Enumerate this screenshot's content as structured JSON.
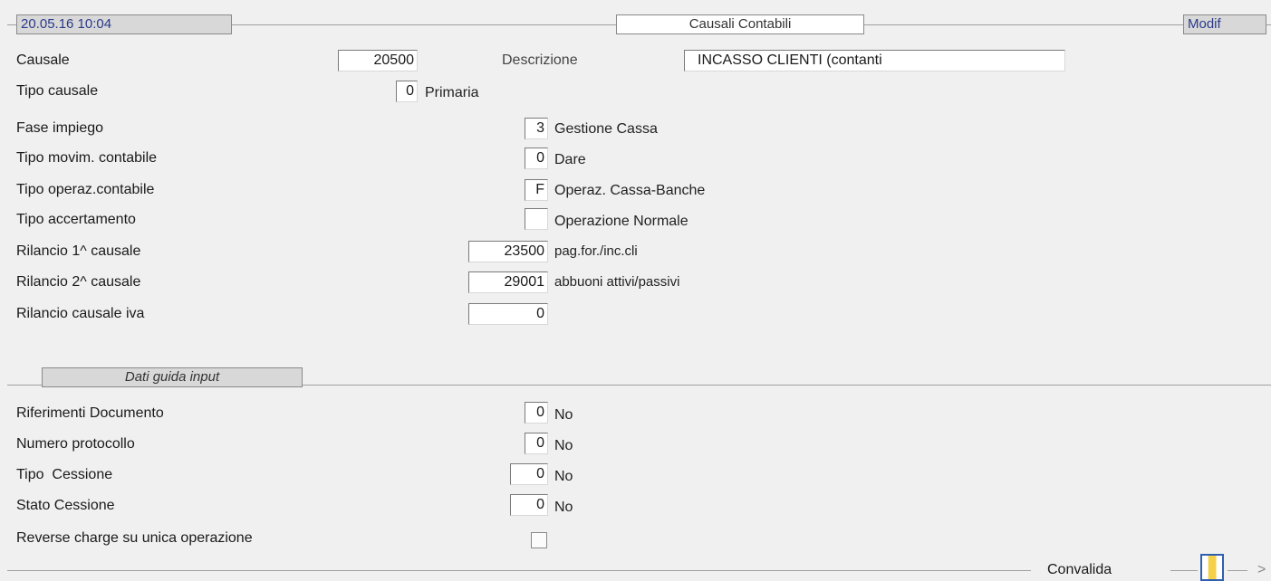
{
  "header": {
    "datetime": "20.05.16 10:04",
    "title": "Causali Contabili",
    "mode": "Modif"
  },
  "form": {
    "causale": {
      "label": "Causale",
      "value": "20500"
    },
    "descrizione": {
      "label": "Descrizione",
      "value": "INCASSO CLIENTI (contanti"
    },
    "tipo_causale": {
      "label": "Tipo causale",
      "value": "0",
      "desc": "Primaria"
    },
    "fase_impiego": {
      "label": "Fase impiego",
      "value": "3",
      "desc": "Gestione Cassa"
    },
    "tipo_movim": {
      "label": "Tipo movim. contabile",
      "value": "0",
      "desc": "Dare"
    },
    "tipo_operaz": {
      "label": "Tipo operaz.contabile",
      "value": "F",
      "desc": "Operaz. Cassa-Banche"
    },
    "tipo_accert": {
      "label": "Tipo accertamento",
      "value": "",
      "desc": "Operazione Normale"
    },
    "rilancio1": {
      "label": "Rilancio 1^ causale",
      "value": "23500",
      "desc": "pag.for./inc.cli"
    },
    "rilancio2": {
      "label": "Rilancio 2^ causale",
      "value": "29001",
      "desc": "abbuoni attivi/passivi"
    },
    "rilancio_iva": {
      "label": "Rilancio causale iva",
      "value": "0"
    }
  },
  "section2": {
    "title": "Dati guida input",
    "rif_doc": {
      "label": "Riferimenti Documento",
      "value": "0",
      "desc": "No"
    },
    "num_prot": {
      "label": "Numero protocollo",
      "value": "0",
      "desc": "No"
    },
    "tipo_cess": {
      "label": "Tipo  Cessione",
      "value": "0",
      "desc": "No"
    },
    "stato_cess": {
      "label": "Stato Cessione",
      "value": "0",
      "desc": "No"
    },
    "reverse_charge": {
      "label": "Reverse charge su unica operazione",
      "checked": false
    }
  },
  "footer": {
    "convalida_label": "Convalida",
    "next_glyph": ">"
  }
}
